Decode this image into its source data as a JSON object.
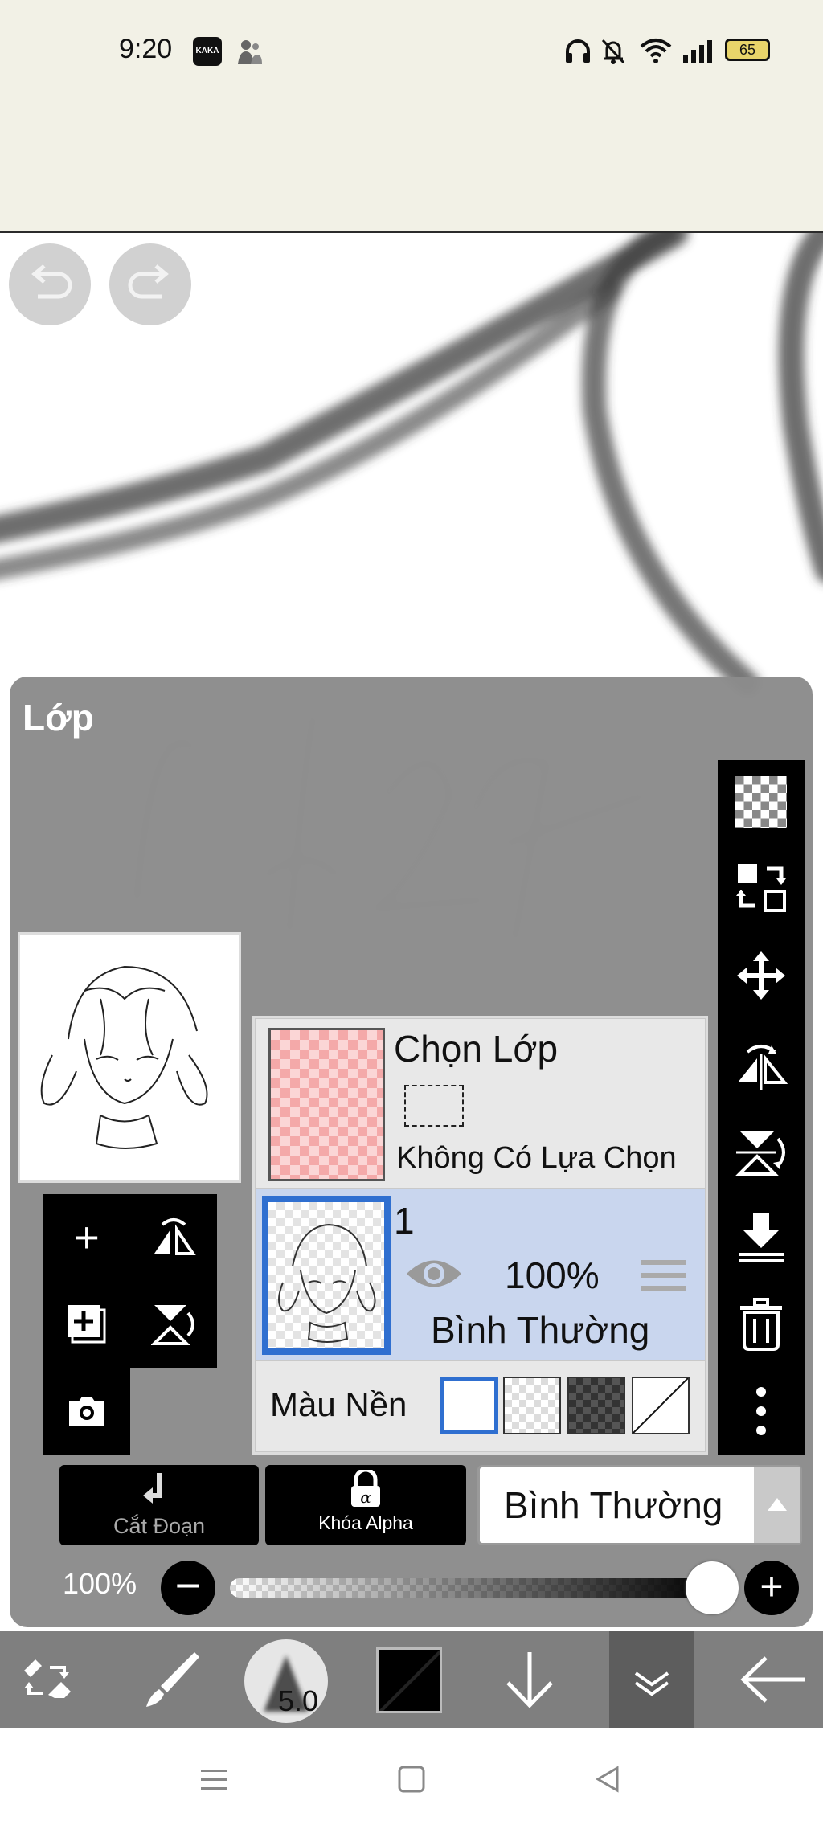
{
  "status_bar": {
    "time": "9:20",
    "app_icon": "KAKA",
    "battery": "65",
    "icons": [
      "headphones-icon",
      "bell-muted-icon",
      "wifi-icon",
      "signal-icon",
      "battery-icon"
    ]
  },
  "canvas": {
    "undo_icon": "undo-icon",
    "redo_icon": "redo-icon"
  },
  "layer_panel": {
    "title": "Lớp",
    "selection_layer": {
      "name": "Chọn Lớp",
      "status": "Không Có Lựa Chọn"
    },
    "layers": [
      {
        "number": "1",
        "opacity": "100%",
        "blend": "Bình Thường",
        "visible": true,
        "selected": true
      }
    ],
    "background": {
      "label": "Màu Nền",
      "options": [
        "white",
        "checker-light",
        "checker-dark",
        "none"
      ],
      "selected": "white"
    },
    "right_tools": [
      "transparency-icon",
      "swap-layer-icon",
      "move-icon",
      "flip-horizontal-icon",
      "flip-vertical-icon",
      "merge-down-icon",
      "trash-icon",
      "more-icon"
    ],
    "left_tools": [
      "add-layer-icon",
      "flip-layer-h-icon",
      "duplicate-layer-icon",
      "flip-layer-v-icon",
      "camera-icon"
    ],
    "clipping_label": "Cắt Đoạn",
    "alpha_lock_label": "Khóa Alpha",
    "blend_mode": "Bình Thường",
    "opacity_label": "100%",
    "opacity_value": 1.0
  },
  "toolbar": {
    "brush_size": "5.0",
    "current_color": "#000000",
    "tools": [
      "transform-icon",
      "brush-icon",
      "brush-size-icon",
      "color-icon",
      "down-arrow-icon",
      "layers-icon",
      "back-arrow-icon"
    ]
  },
  "nav_bar": {
    "buttons": [
      "menu-icon",
      "home-icon",
      "back-icon"
    ]
  }
}
